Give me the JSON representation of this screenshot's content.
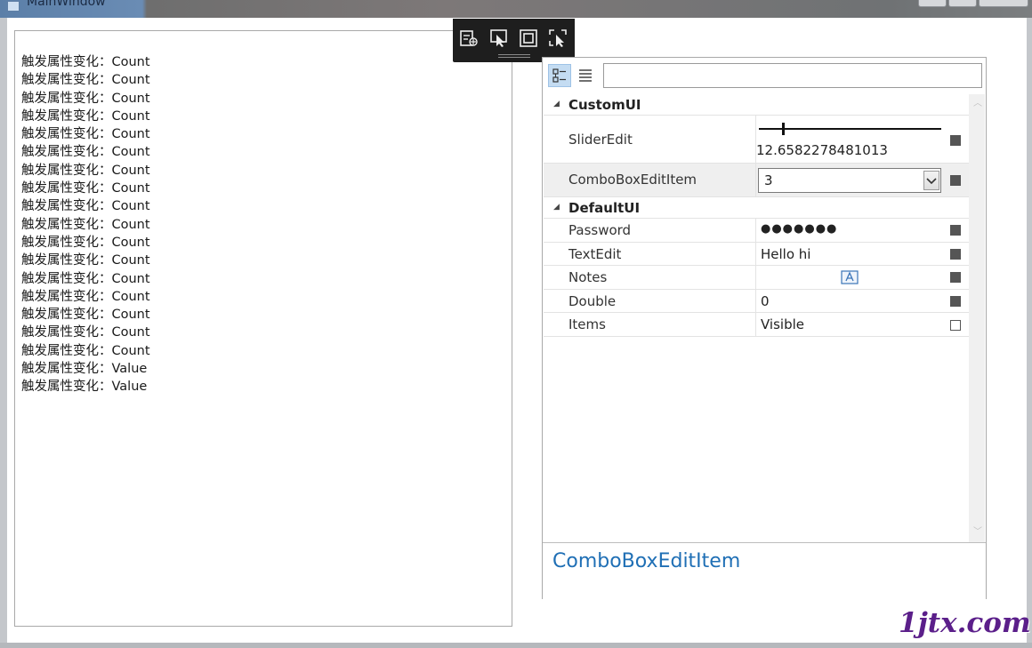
{
  "window": {
    "title": "MainWindow"
  },
  "log": {
    "lines": [
      "触发属性变化：Count",
      "触发属性变化：Count",
      "触发属性变化：Count",
      "触发属性变化：Count",
      "触发属性变化：Count",
      "触发属性变化：Count",
      "触发属性变化：Count",
      "触发属性变化：Count",
      "触发属性变化：Count",
      "触发属性变化：Count",
      "触发属性变化：Count",
      "触发属性变化：Count",
      "触发属性变化：Count",
      "触发属性变化：Count",
      "触发属性变化：Count",
      "触发属性变化：Count",
      "触发属性变化：Count",
      "触发属性变化：Value",
      "触发属性变化：Value"
    ]
  },
  "debug_toolbar": {
    "icons": [
      "select-element-icon",
      "pick-element-icon",
      "layout-adorner-icon",
      "track-focus-icon"
    ]
  },
  "property_grid": {
    "search": {
      "value": "",
      "placeholder": ""
    },
    "categories": [
      {
        "label": "CustomUI"
      },
      {
        "label": "DefaultUI"
      }
    ],
    "properties": {
      "slider_edit": {
        "name": "SliderEdit",
        "value": "12.6582278481013",
        "slider_fraction": 0.13
      },
      "combo_box_edit_item": {
        "name": "ComboBoxEditItem",
        "value": "3"
      },
      "password": {
        "name": "Password",
        "value": "●●●●●●●"
      },
      "text_edit": {
        "name": "TextEdit",
        "value": "Hello hi"
      },
      "notes": {
        "name": "Notes",
        "value": ""
      },
      "double": {
        "name": "Double",
        "value": "0"
      },
      "items": {
        "name": "Items",
        "value": "Visible"
      }
    },
    "description": {
      "title": "ComboBoxEditItem"
    }
  },
  "watermark": {
    "text": "1jtx.com"
  },
  "colors": {
    "accent": "#1f6fb5",
    "selection": "#c4dcf2",
    "watermark": "#5b1f8a"
  }
}
